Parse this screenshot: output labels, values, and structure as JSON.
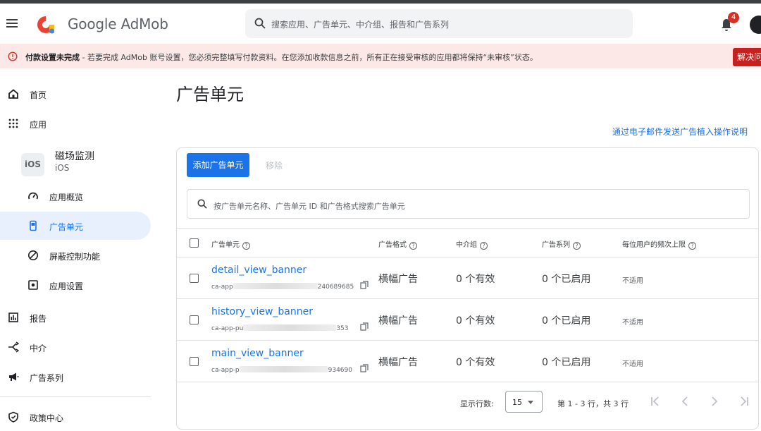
{
  "header": {
    "brand": "Google AdMob",
    "search_placeholder": "搜索应用、广告单元、中介组、报告和广告系列",
    "notification_count": "4"
  },
  "alert": {
    "title": "付款设置未完成",
    "message": " - 若要完成 AdMob 账号设置，您必须完整填写付款资料。在您添加收款信息之前，所有正在接受审核的应用都将保持“未审核”状态。",
    "action": "解决问"
  },
  "sidebar": {
    "home": "首页",
    "apps": "应用",
    "app": {
      "badge": "iOS",
      "name": "磁场监测",
      "platform": "iOS"
    },
    "overview": "应用概览",
    "ad_units": "广告单元",
    "blocking": "屏蔽控制功能",
    "app_settings": "应用设置",
    "reports": "报告",
    "mediation": "中介",
    "campaigns": "广告系列",
    "policy": "政策中心"
  },
  "main": {
    "title": "广告单元",
    "email_link": "通过电子邮件发送广告植入操作说明",
    "add_button": "添加广告单元",
    "remove_button": "移除",
    "table_search_placeholder": "按广告单元名称、广告单元 ID 和广告格式搜索广告单元",
    "columns": {
      "ad_unit": "广告单元",
      "format": "广告格式",
      "mediation": "中介组",
      "campaigns": "广告系列",
      "frequency": "每位用户的频次上限"
    },
    "rows": [
      {
        "name": "detail_view_banner",
        "id_prefix": "ca-app",
        "id_suffix": "240689685",
        "format": "横幅广告",
        "mediation": "0 个有效",
        "campaigns": "0 个已启用",
        "frequency": "不适用"
      },
      {
        "name": "history_view_banner",
        "id_prefix": "ca-app-pu",
        "id_suffix": "353",
        "format": "横幅广告",
        "mediation": "0 个有效",
        "campaigns": "0 个已启用",
        "frequency": "不适用"
      },
      {
        "name": "main_view_banner",
        "id_prefix": "ca-app-p",
        "id_suffix": "934690",
        "format": "横幅广告",
        "mediation": "0 个有效",
        "campaigns": "0 个已启用",
        "frequency": "不适用"
      }
    ],
    "footer": {
      "rows_label": "显示行数:",
      "rows_value": "15",
      "range": "第 1 - 3 行，共 3 行"
    }
  },
  "colors": {
    "accent": "#1a73e8",
    "alert_bg": "#fce8e6",
    "alert_button": "#c5221f",
    "badge": "#d93025"
  }
}
